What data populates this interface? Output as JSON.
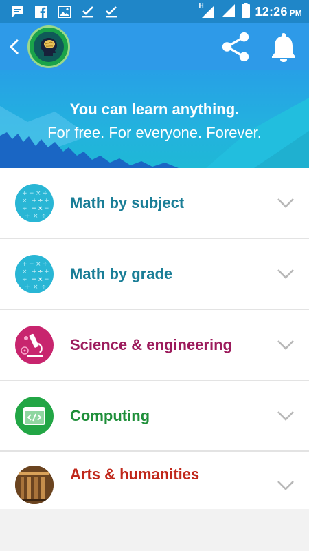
{
  "status_bar": {
    "time": "12:26",
    "ampm": "PM",
    "network": "H"
  },
  "app_bar": {
    "back": "back-icon",
    "logo": "brain-logo",
    "share": "share-icon",
    "notifications": "bell-icon"
  },
  "hero": {
    "title": "You can learn anything.",
    "subtitle": "For free. For everyone. Forever."
  },
  "categories": [
    {
      "label": "Math by subject",
      "color": "#1a7e97",
      "icon_bg": "#29b6d5",
      "icon": "math-icon"
    },
    {
      "label": "Math by grade",
      "color": "#1a7e97",
      "icon_bg": "#29b6d5",
      "icon": "math-icon"
    },
    {
      "label": "Science & engineering",
      "color": "#9c1b5c",
      "icon_bg": "#c8256e",
      "icon": "microscope-icon"
    },
    {
      "label": "Computing",
      "color": "#1f8f3a",
      "icon_bg": "#22a645",
      "icon": "code-window-icon"
    },
    {
      "label": "Arts & humanities",
      "color": "#c0281b",
      "icon_bg": "#8a5a2b",
      "icon": "library-icon"
    }
  ]
}
